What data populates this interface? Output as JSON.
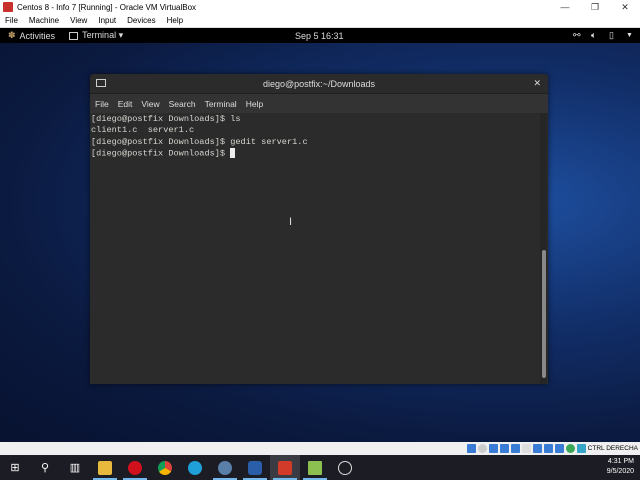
{
  "vbox": {
    "title": "Centos 8 - Info 7 [Running] - Oracle VM VirtualBox",
    "menu": [
      "File",
      "Machine",
      "View",
      "Input",
      "Devices",
      "Help"
    ],
    "host_key": "CTRL DERECHA"
  },
  "gnome": {
    "activities": "Activities",
    "app": "Terminal ▾",
    "clock": "Sep 5  16:31"
  },
  "terminal": {
    "title": "diego@postfix:~/Downloads",
    "menu": [
      "File",
      "Edit",
      "View",
      "Search",
      "Terminal",
      "Help"
    ],
    "lines": [
      "[diego@postfix Downloads]$ ls",
      "client1.c  server1.c",
      "[diego@postfix Downloads]$ gedit server1.c",
      "[diego@postfix Downloads]$ "
    ],
    "scroll_position": 1.0
  },
  "taskbar": {
    "time": "4:31 PM",
    "date": "9/5/2020"
  }
}
